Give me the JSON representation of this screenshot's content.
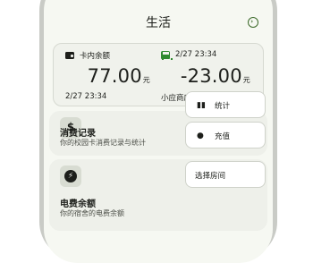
{
  "header": {
    "title": "生活"
  },
  "balance": {
    "card_label": "卡内余额",
    "amount": "77.00",
    "unit": "元",
    "time": "2/27 23:34"
  },
  "last_transaction": {
    "time_label": "2/27 23:34",
    "amount": "-23.00",
    "unit": "元",
    "merchant": "小应商店"
  },
  "consumption": {
    "icon": "$",
    "title": "消费记录",
    "subtitle": "你的校园卡消费记录与统计",
    "stats_label": "统计",
    "recharge_label": "充值"
  },
  "electricity": {
    "icon": "⚡",
    "select_room_label": "选择房间",
    "title": "电费余额",
    "subtitle": "你的宿舍的电费余额"
  },
  "colors": {
    "accent": "#3c6a2a",
    "bus_green": "#2f8a2f"
  },
  "icons": [
    "logout-icon",
    "wallet-icon",
    "bus-icon",
    "dollar-icon",
    "stats-icon",
    "piggy-bank-icon",
    "bolt-icon"
  ]
}
